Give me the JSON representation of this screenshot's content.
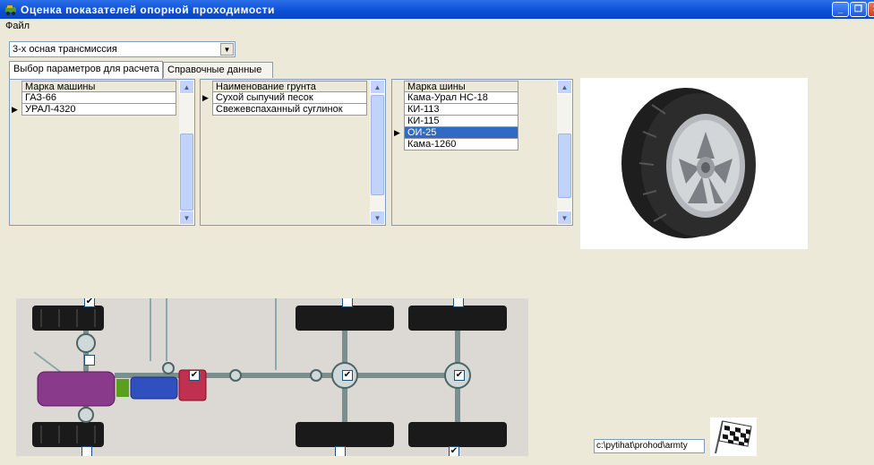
{
  "window": {
    "title": "Оценка показателей опорной проходимости"
  },
  "menu": {
    "file": "Файл"
  },
  "transmission": {
    "selected": "3-х осная трансмиссия"
  },
  "tabs": [
    {
      "label": "Выбор параметров для расчета",
      "active": true
    },
    {
      "label": "Справочные данные",
      "active": false
    }
  ],
  "grid_machines": {
    "header": "Марка машины",
    "rows": [
      "ГАЗ-66",
      "УРАЛ-4320"
    ],
    "current_row": 1
  },
  "grid_soil": {
    "header": "Наименование грунта",
    "rows": [
      "Сухой сыпучий песок",
      "Свежевспаханный суглинок"
    ],
    "current_row": 0
  },
  "grid_tires": {
    "header": "Марка шины",
    "rows": [
      "Кама-Урал НС-18",
      "КИ-113",
      "КИ-115",
      "ОИ-25",
      "Кама-1260"
    ],
    "current_row": 3,
    "highlighted_row": 3
  },
  "path": {
    "value": "c:\\pytihat\\prohod\\armty"
  },
  "checkmark": "✔",
  "colors": {
    "titlebar": "#0a4fd6",
    "selection": "#316ac5",
    "engine": "#8a3a8a",
    "gearbox": "#3050c0",
    "transfer": "#c03050"
  }
}
